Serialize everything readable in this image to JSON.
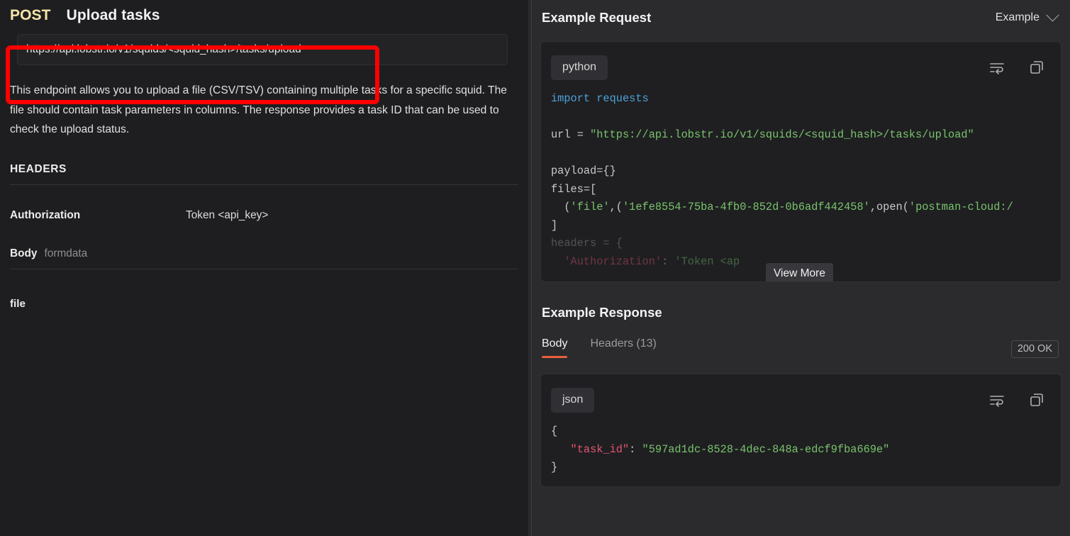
{
  "left": {
    "method": "POST",
    "endpoint_title": "Upload tasks",
    "url": "https://api.lobstr.io/v1/squids/<squid_hash>/tasks/upload",
    "description": "This endpoint allows you to upload a file (CSV/TSV) containing multiple tasks for a specific squid. The file should contain task parameters in columns. The response provides a task ID that can be used to check the upload status.",
    "headers_label": "HEADERS",
    "headers": [
      {
        "key": "Authorization",
        "value": "Token <api_key>"
      }
    ],
    "body_label": "Body",
    "body_type": "formdata",
    "body_fields": [
      {
        "key": "file"
      }
    ]
  },
  "right": {
    "request_title": "Example Request",
    "example_selector": "Example",
    "request_code": {
      "language": "python",
      "lines": [
        "import requests",
        "",
        "url = \"https://api.lobstr.io/v1/squids/<squid_hash>/tasks/upload\"",
        "",
        "payload={}",
        "files=[",
        "  ('file',('1efe8554-75ba-4fb0-852d-0b6adf442458',open('postman-cloud:/",
        "]",
        "headers = {",
        "  'Authorization': 'Token <ap"
      ]
    },
    "view_more_label": "View More",
    "response_title": "Example Response",
    "tabs": [
      {
        "label": "Body",
        "active": true
      },
      {
        "label": "Headers (13)",
        "active": false
      }
    ],
    "status": "200 OK",
    "response_code": {
      "language": "json",
      "open_brace": "{",
      "key": "\"task_id\"",
      "colon": ": ",
      "value": "\"597ad1dc-8528-4dec-848a-edcf9fba669e\"",
      "close_brace": "}"
    },
    "icons": {
      "wrap": "word-wrap-icon",
      "copy": "copy-icon"
    }
  },
  "annotation": {
    "highlight_color": "#ff0000"
  }
}
